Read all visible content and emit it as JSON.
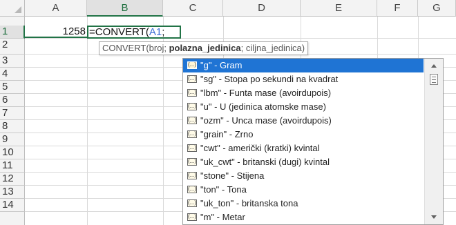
{
  "columns": [
    "A",
    "B",
    "C",
    "D",
    "E",
    "F",
    "G"
  ],
  "rows": [
    "1",
    "2",
    "3",
    "4",
    "5",
    "6",
    "7",
    "8",
    "9",
    "10",
    "11",
    "12",
    "13",
    "14"
  ],
  "cells": {
    "a1": "1258",
    "b1_fn": "=CONVERT(",
    "b1_ref": "A1",
    "b1_sep": ";"
  },
  "tooltip": {
    "prefix": "CONVERT(broj; ",
    "bold": "polazna_jedinica",
    "suffix": "; ciljna_jedinica)"
  },
  "autocomplete": {
    "icon": "function-icon",
    "items": [
      "\"g\" - Gram",
      "\"sg\" - Stopa po sekundi na kvadrat",
      "\"lbm\" - Funta mase (avoirdupois)",
      "\"u\" - U (jedinica atomske mase)",
      "\"ozm\" - Unca mase (avoirdupois)",
      "\"grain\" - Zrno",
      "\"cwt\" - američki (kratki) kvintal",
      "\"uk_cwt\" - britanski (dugi) kvintal",
      "\"stone\" - Stijena",
      "\"ton\" - Tona",
      "\"uk_ton\" - britanska tona",
      "\"m\" - Metar"
    ],
    "selected_index": 0,
    "highlight_color": "#1f74d4"
  },
  "accent_color": "#217346"
}
